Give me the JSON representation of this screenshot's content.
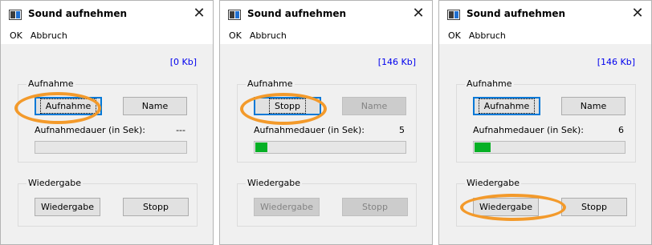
{
  "windows": [
    {
      "title": "Sound aufnehmen",
      "close_glyph": "✕",
      "menu": {
        "ok_label": "OK",
        "cancel_label": "Abbruch"
      },
      "size_text": "[0 Kb]",
      "recording": {
        "group_label": "Aufnahme",
        "primary_button": "Aufnahme",
        "primary_state": "default",
        "name_button": "Name",
        "name_state": "enabled",
        "duration_label": "Aufnahmedauer (in Sek):",
        "duration_value": "---",
        "progress_fraction": 0
      },
      "playback": {
        "group_label": "Wiedergabe",
        "play_button": "Wiedergabe",
        "play_state": "enabled",
        "stop_button": "Stopp",
        "stop_state": "enabled"
      },
      "highlighted": "primary_button"
    },
    {
      "title": "Sound aufnehmen",
      "close_glyph": "✕",
      "menu": {
        "ok_label": "OK",
        "cancel_label": "Abbruch"
      },
      "size_text": "[146 Kb]",
      "recording": {
        "group_label": "Aufnahme",
        "primary_button": "Stopp",
        "primary_state": "default",
        "name_button": "Name",
        "name_state": "disabled",
        "duration_label": "Aufnahmedauer (in Sek):",
        "duration_value": "5",
        "progress_fraction": 0.08
      },
      "playback": {
        "group_label": "Wiedergabe",
        "play_button": "Wiedergabe",
        "play_state": "disabled",
        "stop_button": "Stopp",
        "stop_state": "disabled"
      },
      "highlighted": "primary_button"
    },
    {
      "title": "Sound aufnehmen",
      "close_glyph": "✕",
      "menu": {
        "ok_label": "OK",
        "cancel_label": "Abbruch"
      },
      "size_text": "[146 Kb]",
      "recording": {
        "group_label": "Aufnahme",
        "primary_button": "Aufnahme",
        "primary_state": "default",
        "name_button": "Name",
        "name_state": "enabled",
        "duration_label": "Aufnahmedauer (in Sek):",
        "duration_value": "6",
        "progress_fraction": 0.11
      },
      "playback": {
        "group_label": "Wiedergabe",
        "play_button": "Wiedergabe",
        "play_state": "enabled",
        "stop_button": "Stopp",
        "stop_state": "enabled"
      },
      "highlighted": "play_button"
    }
  ],
  "colors": {
    "highlight_ring": "#f39a2b",
    "progress_fill": "#06b025",
    "size_text": "#0000ee",
    "default_button_border": "#0078d7"
  }
}
